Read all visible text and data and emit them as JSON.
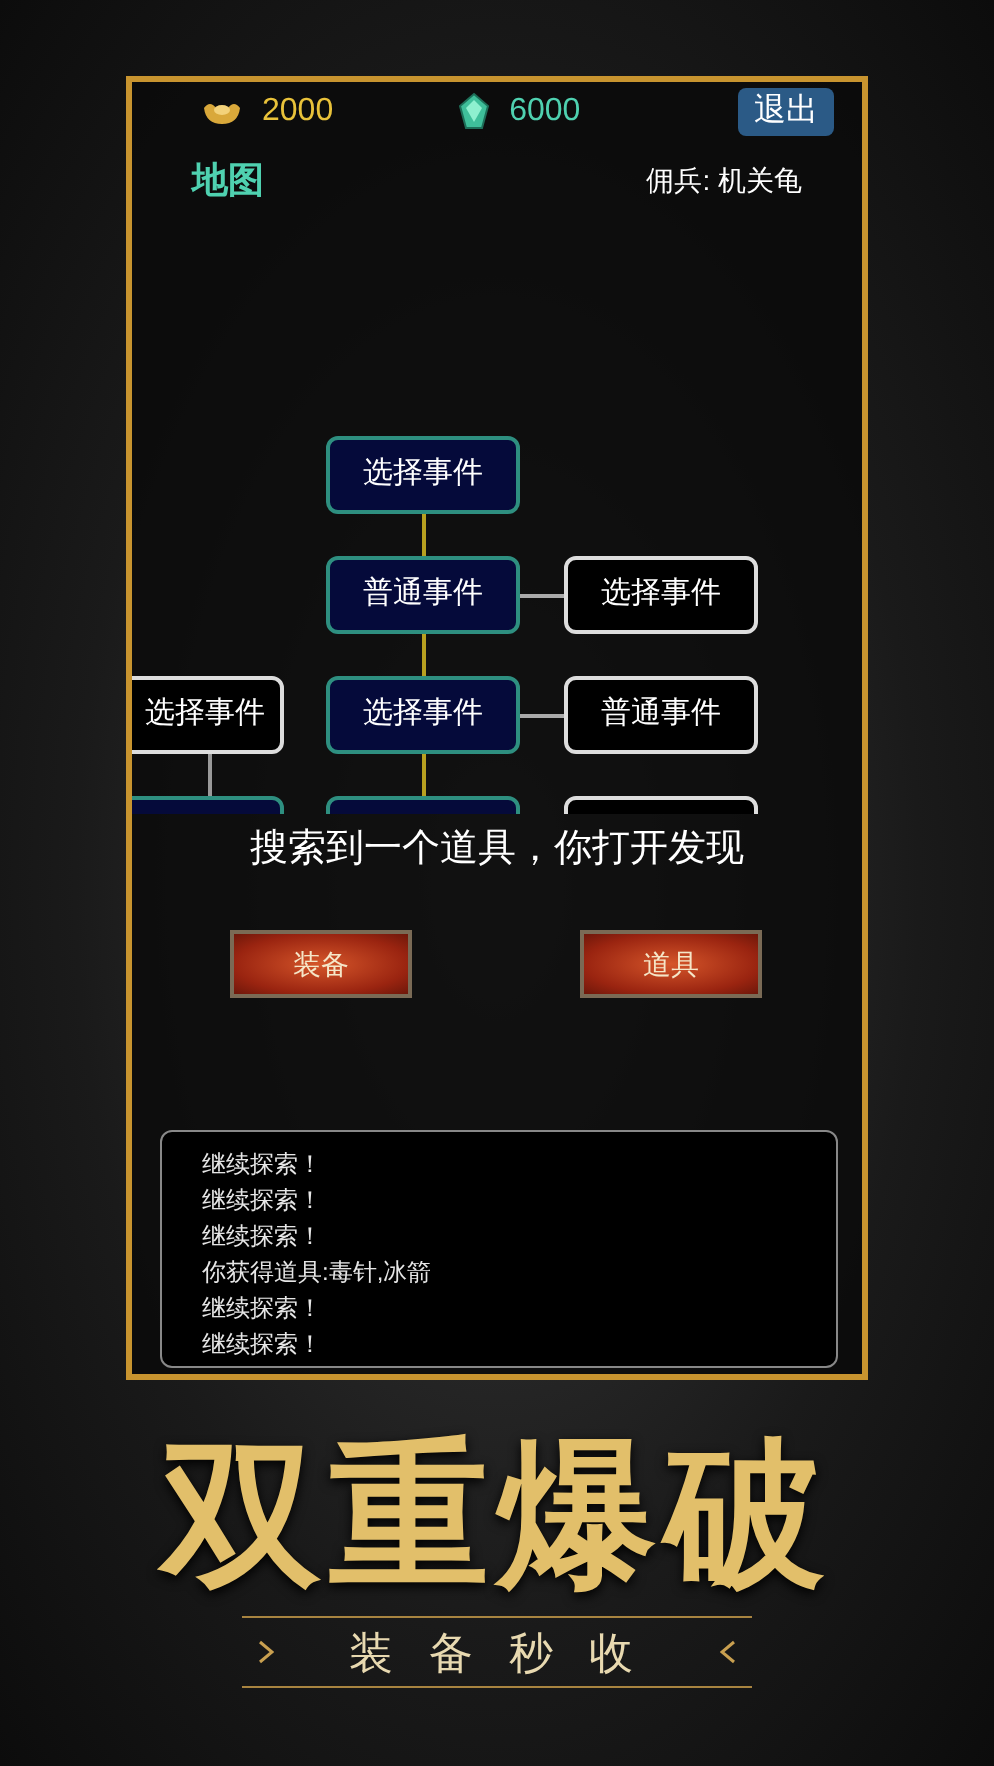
{
  "currencies": [
    {
      "kind": "gold",
      "amount": "2000"
    },
    {
      "kind": "gem",
      "amount": "6000"
    }
  ],
  "exit_button": "退出",
  "map_title": "地图",
  "mercenary": "佣兵: 机关龟",
  "map": {
    "rows": [
      {
        "center": {
          "label": "选择事件",
          "kind": "visited"
        }
      },
      {
        "center": {
          "label": "普通事件",
          "kind": "visited"
        },
        "right": {
          "label": "选择事件",
          "kind": "unvisited"
        }
      },
      {
        "left": {
          "label": "选择事件",
          "kind": "unvisited"
        },
        "center": {
          "label": "选择事件",
          "kind": "visited"
        },
        "right": {
          "label": "普通事件",
          "kind": "unvisited"
        }
      },
      {
        "left": {
          "kind": "visited"
        },
        "center": {
          "kind": "visited"
        },
        "right": {
          "kind": "unvisited"
        }
      }
    ]
  },
  "message": "搜索到一个道具，你打开发现",
  "choices": [
    "装备",
    "道具"
  ],
  "log": [
    "继续探索！",
    "继续探索！",
    "继续探索！",
    "你获得道具:毒针,冰箭",
    "继续探索！",
    "继续探索！"
  ],
  "banner": {
    "headline": "双重爆破",
    "tagline": "装 备 秒 收"
  }
}
